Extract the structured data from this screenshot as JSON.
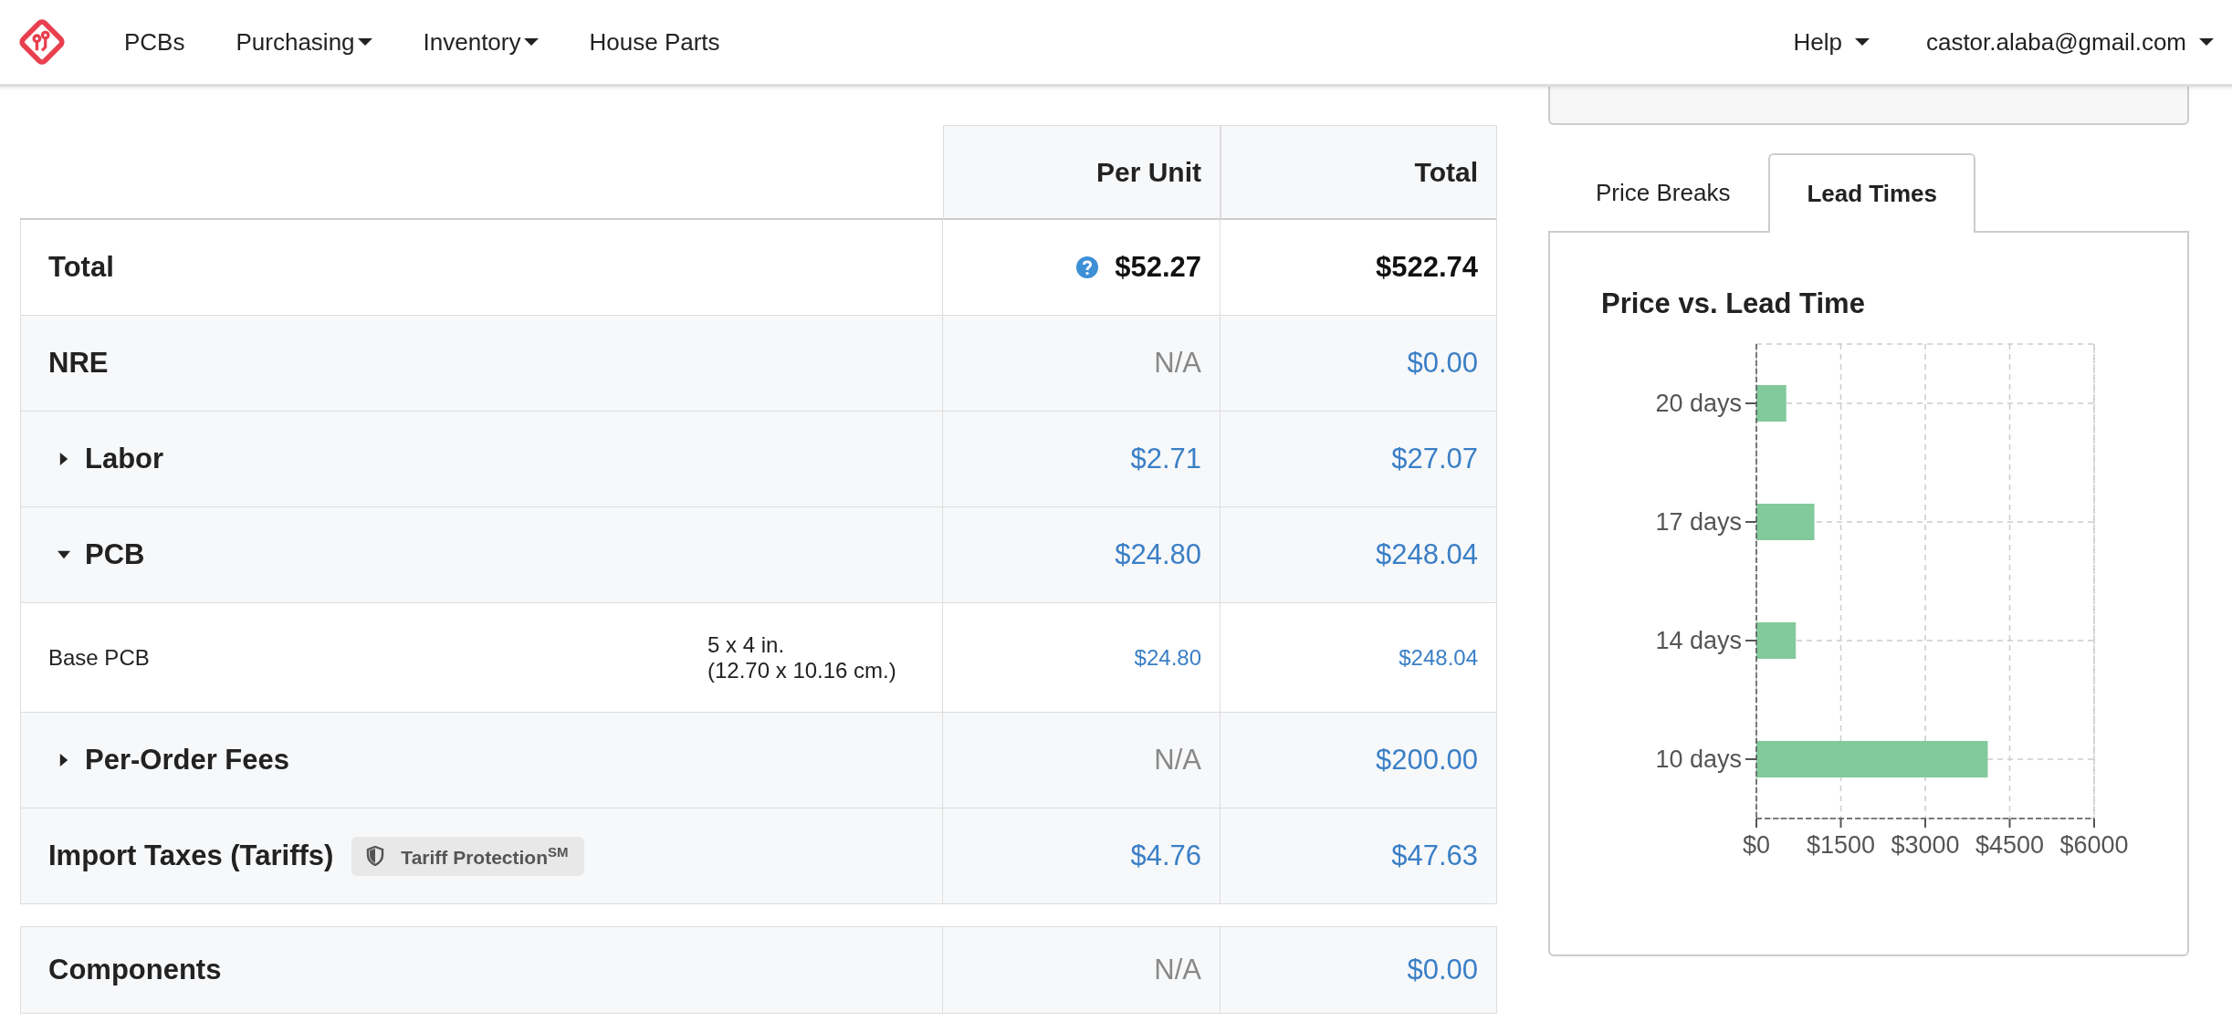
{
  "navbar": {
    "items": [
      {
        "label": "PCBs",
        "dropdown": false
      },
      {
        "label": "Purchasing",
        "dropdown": true
      },
      {
        "label": "Inventory",
        "dropdown": true
      },
      {
        "label": "House Parts",
        "dropdown": false
      }
    ],
    "right_items": [
      {
        "label": "Help",
        "dropdown": true
      },
      {
        "label": "castor.alaba@gmail.com",
        "dropdown": true
      }
    ]
  },
  "cost_table": {
    "columns": [
      "Per Unit",
      "Total"
    ],
    "rows": [
      {
        "kind": "total",
        "label": "Total",
        "help": true,
        "per_unit": {
          "text": "$52.27",
          "kind": "strong"
        },
        "total": {
          "text": "$522.74",
          "kind": "strong"
        }
      },
      {
        "kind": "section",
        "label": "NRE",
        "per_unit": {
          "text": "N/A",
          "kind": "muted"
        },
        "total": {
          "text": "$0.00",
          "kind": "link"
        }
      },
      {
        "kind": "section",
        "label": "Labor",
        "expanded": false,
        "per_unit": {
          "text": "$2.71",
          "kind": "link"
        },
        "total": {
          "text": "$27.07",
          "kind": "link"
        }
      },
      {
        "kind": "section",
        "label": "PCB",
        "expanded": true,
        "per_unit": {
          "text": "$24.80",
          "kind": "link"
        },
        "total": {
          "text": "$248.04",
          "kind": "link"
        }
      },
      {
        "kind": "detail",
        "label": "Base PCB",
        "spec": [
          "5 x 4 in.",
          "(12.70 x 10.16 cm.)"
        ],
        "per_unit": {
          "text": "$24.80",
          "kind": "link"
        },
        "total": {
          "text": "$248.04",
          "kind": "link"
        }
      },
      {
        "kind": "section",
        "label": "Per-Order Fees",
        "expanded": false,
        "per_unit": {
          "text": "N/A",
          "kind": "muted"
        },
        "total": {
          "text": "$200.00",
          "kind": "link"
        }
      },
      {
        "kind": "section",
        "label": "Import Taxes (Tariffs)",
        "badge": "Tariff Protection$^{SM}$",
        "per_unit": {
          "text": "$4.76",
          "kind": "link"
        },
        "total": {
          "text": "$47.63",
          "kind": "link"
        }
      }
    ],
    "components_row": {
      "label": "Components",
      "per_unit": {
        "text": "N/A",
        "kind": "muted"
      },
      "total": {
        "text": "$0.00",
        "kind": "link"
      }
    }
  },
  "side_panel": {
    "tabs": [
      {
        "label": "Price Breaks",
        "selected": false
      },
      {
        "label": "Lead Times",
        "selected": true
      }
    ],
    "chart": {
      "title": "Price vs. Lead Time",
      "chart_data": {
        "type": "bar",
        "orientation": "horizontal",
        "categories": [
          "20 days",
          "17 days",
          "14 days",
          "10 days"
        ],
        "grid": true,
        "series": [
          {
            "color": "#82c99b",
            "values": [
              530,
              1030,
              700,
              4110
            ]
          }
        ],
        "xlim": [
          0,
          6000
        ],
        "xticks": [
          {
            "value": 0,
            "label": "$0"
          },
          {
            "value": 1500,
            "label": "$1500"
          },
          {
            "value": 3000,
            "label": "$3000"
          },
          {
            "value": 4500,
            "label": "$4500"
          },
          {
            "value": 6000,
            "label": "$6000"
          }
        ]
      }
    }
  }
}
